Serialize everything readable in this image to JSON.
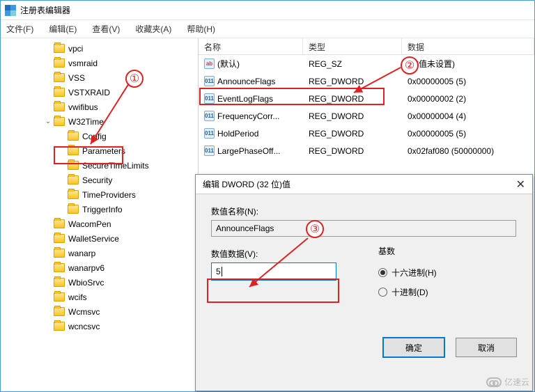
{
  "window_title": "注册表编辑器",
  "menu": [
    "文件(F)",
    "编辑(E)",
    "查看(V)",
    "收藏夹(A)",
    "帮助(H)"
  ],
  "tree": [
    {
      "label": "vpci",
      "indent": 62
    },
    {
      "label": "vsmraid",
      "indent": 62
    },
    {
      "label": "VSS",
      "indent": 62
    },
    {
      "label": "VSTXRAID",
      "indent": 62
    },
    {
      "label": "vwifibus",
      "indent": 62
    },
    {
      "label": "W32Time",
      "indent": 62,
      "expander": "⌄"
    },
    {
      "label": "Config",
      "indent": 82,
      "selected": true
    },
    {
      "label": "Parameters",
      "indent": 82
    },
    {
      "label": "SecureTimeLimits",
      "indent": 82
    },
    {
      "label": "Security",
      "indent": 82
    },
    {
      "label": "TimeProviders",
      "indent": 82
    },
    {
      "label": "TriggerInfo",
      "indent": 82
    },
    {
      "label": "WacomPen",
      "indent": 62
    },
    {
      "label": "WalletService",
      "indent": 62
    },
    {
      "label": "wanarp",
      "indent": 62
    },
    {
      "label": "wanarpv6",
      "indent": 62
    },
    {
      "label": "WbioSrvc",
      "indent": 62
    },
    {
      "label": "wcifs",
      "indent": 62
    },
    {
      "label": "Wcmsvc",
      "indent": 62
    },
    {
      "label": "wcncsvc",
      "indent": 62
    }
  ],
  "list_headers": {
    "name": "名称",
    "type": "类型",
    "data": "数据"
  },
  "list_rows": [
    {
      "name": "(默认)",
      "type": "REG_SZ",
      "data": "(数值未设置)",
      "icon": "str"
    },
    {
      "name": "AnnounceFlags",
      "type": "REG_DWORD",
      "data": "0x00000005 (5)",
      "icon": "bin"
    },
    {
      "name": "EventLogFlags",
      "type": "REG_DWORD",
      "data": "0x00000002 (2)",
      "icon": "bin"
    },
    {
      "name": "FrequencyCorr...",
      "type": "REG_DWORD",
      "data": "0x00000004 (4)",
      "icon": "bin"
    },
    {
      "name": "HoldPeriod",
      "type": "REG_DWORD",
      "data": "0x00000005 (5)",
      "icon": "bin"
    },
    {
      "name": "LargePhaseOff...",
      "type": "REG_DWORD",
      "data": "0x02faf080 (50000000)",
      "icon": "bin"
    }
  ],
  "dialog": {
    "title": "编辑 DWORD (32 位)值",
    "name_label": "数值名称(N):",
    "name_value": "AnnounceFlags",
    "data_label": "数值数据(V):",
    "data_value": "5",
    "radix_label": "基数",
    "radix_hex": "十六进制(H)",
    "radix_dec": "十进制(D)",
    "ok": "确定",
    "cancel": "取消"
  },
  "annotations": {
    "n1": "①",
    "n2": "②",
    "n3": "③"
  },
  "watermark": "亿速云"
}
